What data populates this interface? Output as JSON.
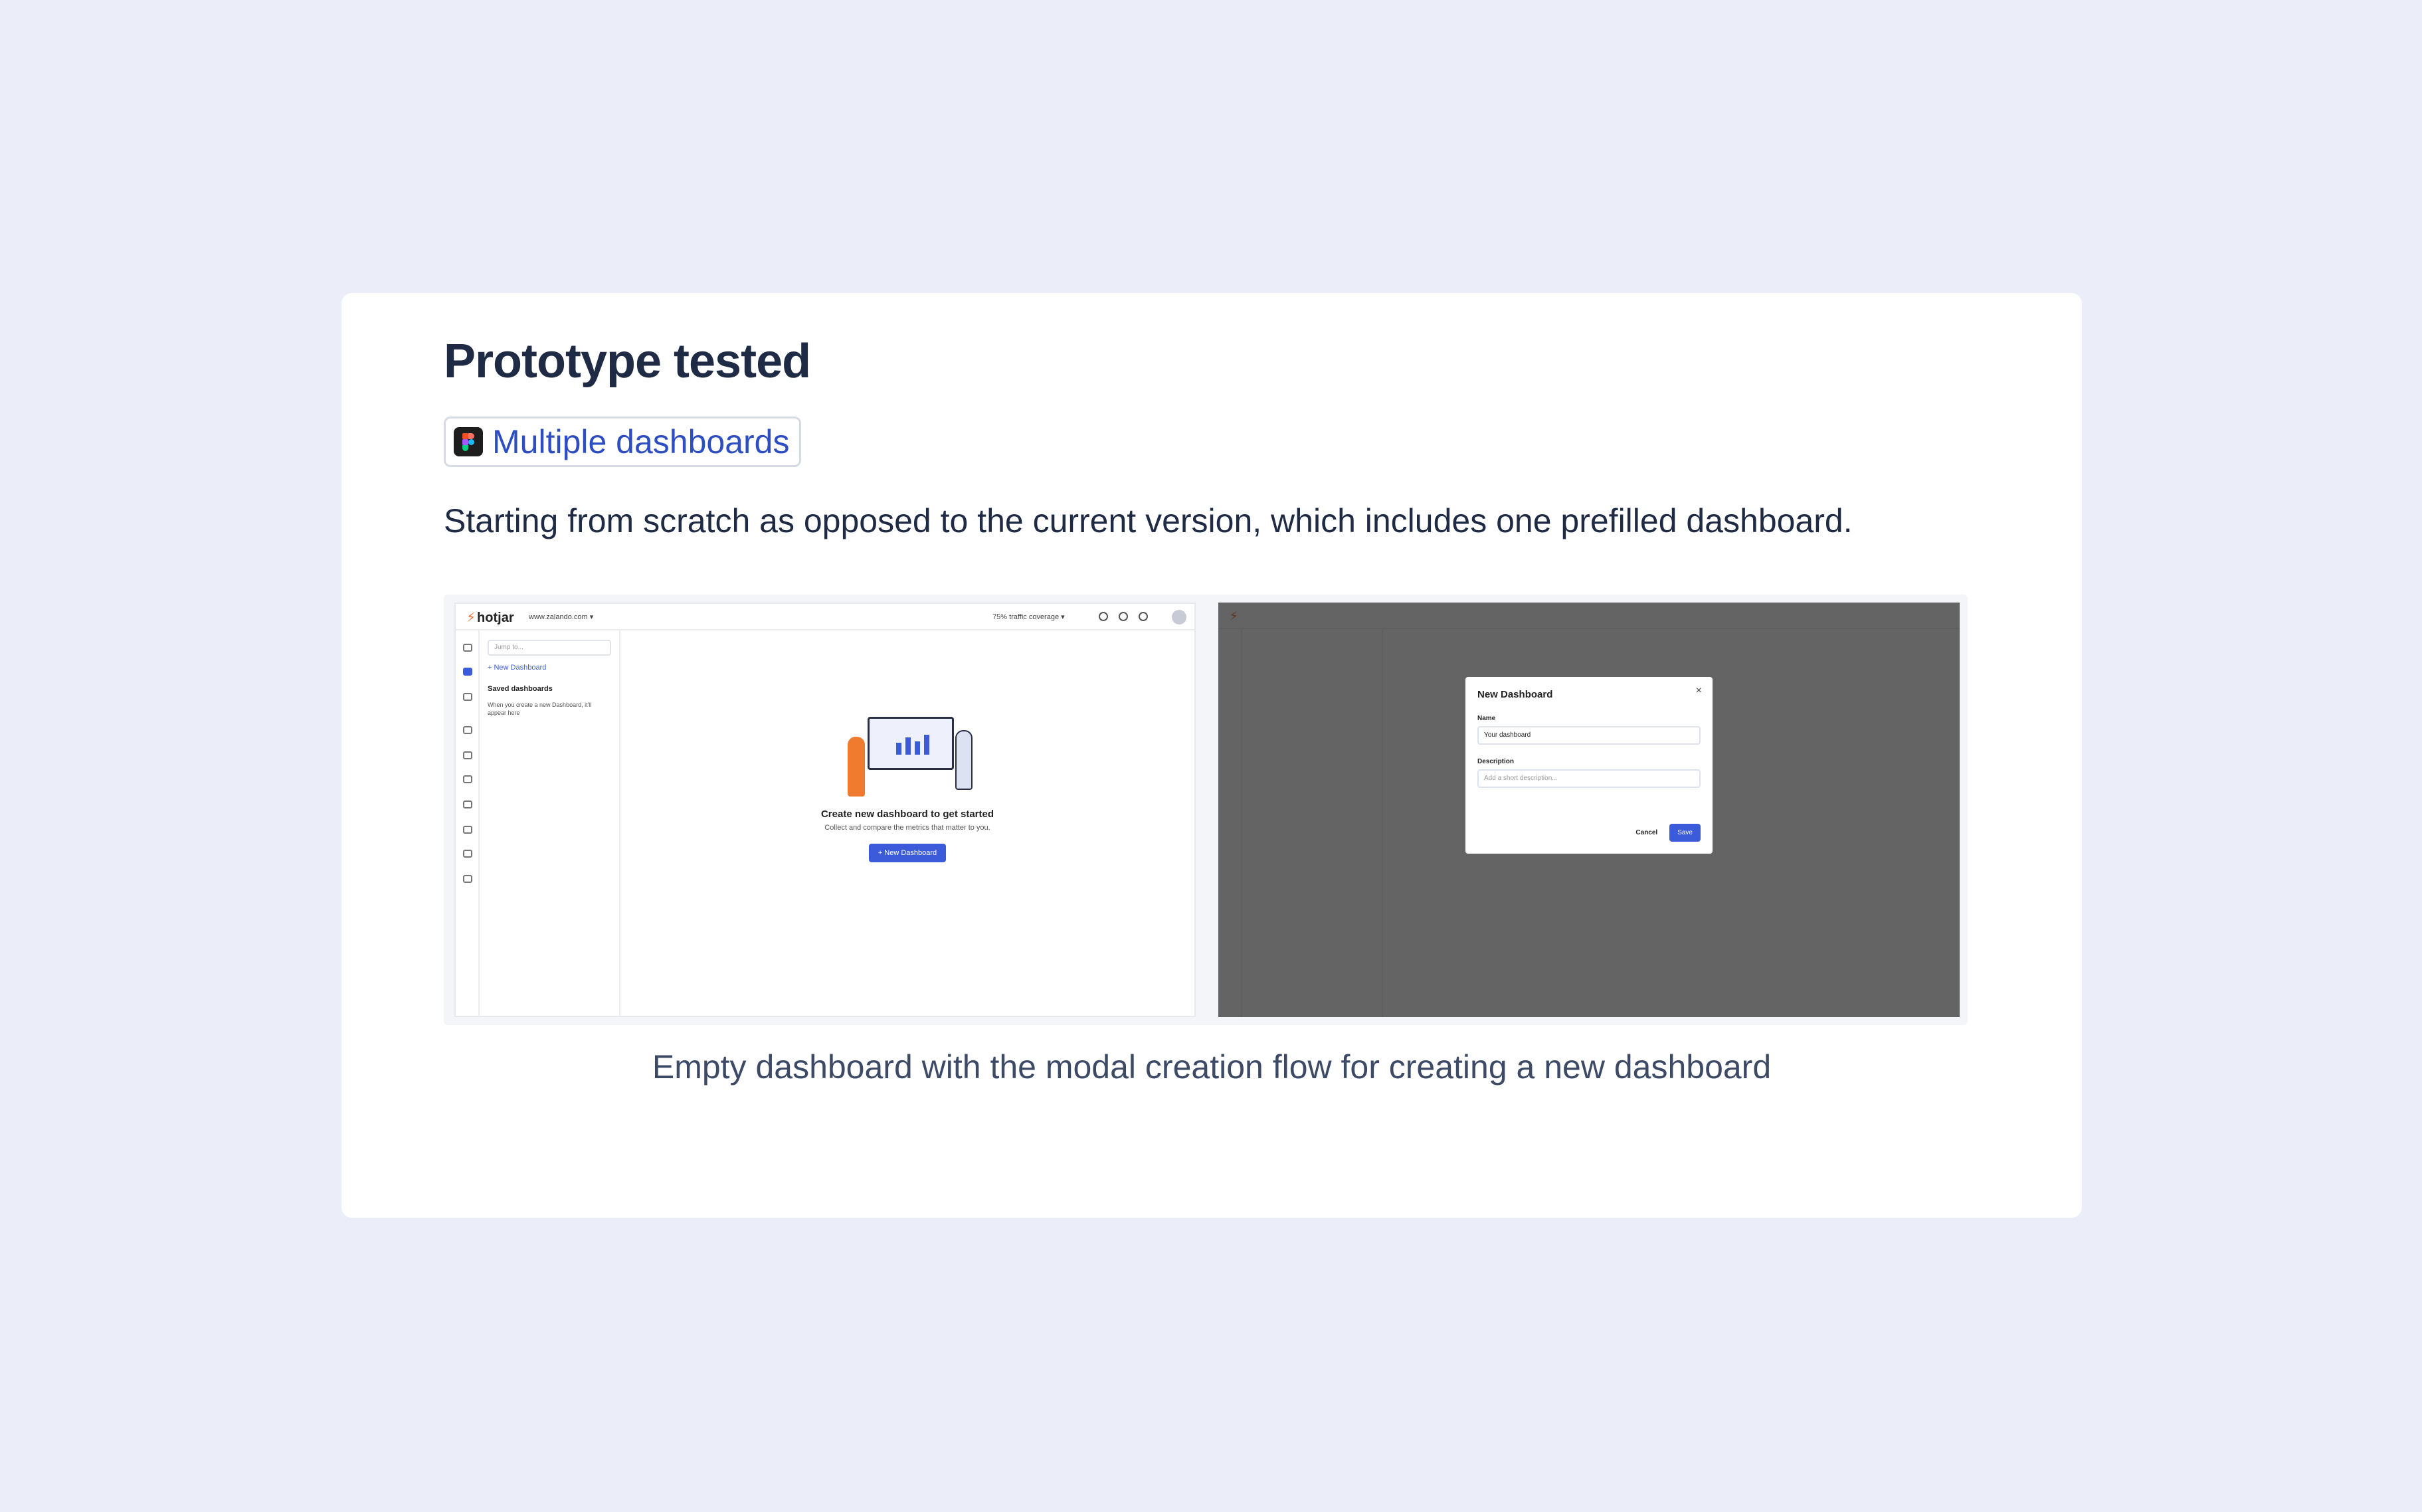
{
  "page": {
    "title": "Prototype tested",
    "link_label": "Multiple dashboards",
    "link_icon": "figma-icon",
    "description": "Starting from scratch as opposed to the current version, which includes one prefilled dashboard.",
    "caption": "Empty dashboard with the modal creation flow for creating a new dashboard"
  },
  "app": {
    "logo": "hotjar",
    "site": "www.zalando.com ▾",
    "coverage": "75% traffic coverage ▾",
    "search_placeholder": "Jump to...",
    "new_dashboard_link": "+ New Dashboard",
    "saved_heading": "Saved dashboards",
    "saved_hint": "When you create a new Dashboard, it'll appear here",
    "empty_title": "Create new dashboard to get started",
    "empty_subtitle": "Collect and compare the metrics that matter to you.",
    "empty_button": "+ New Dashboard"
  },
  "modal": {
    "title": "New Dashboard",
    "close": "×",
    "name_label": "Name",
    "name_value": "Your dashboard",
    "description_label": "Description",
    "description_placeholder": "Add a short description...",
    "cancel_label": "Cancel",
    "save_label": "Save"
  },
  "colors": {
    "accent": "#3b5bdb",
    "link": "#2d4ec3",
    "background": "#ebeef8"
  }
}
